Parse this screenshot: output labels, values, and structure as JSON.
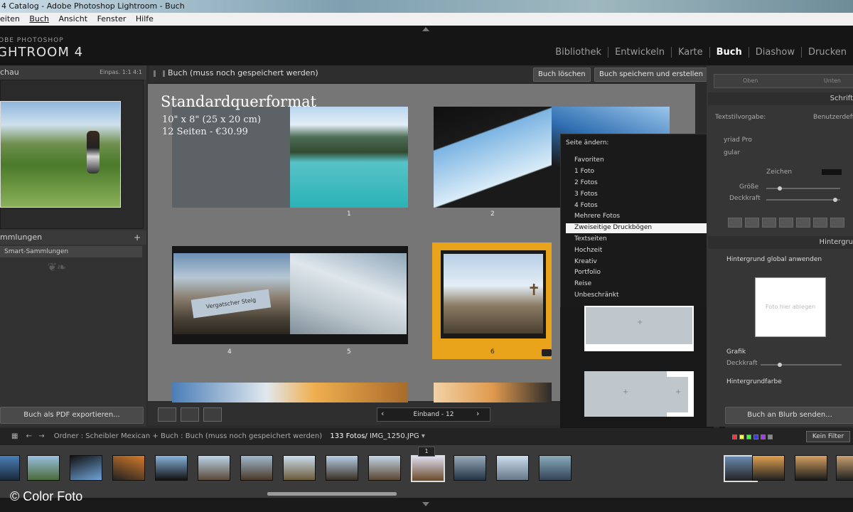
{
  "window": {
    "title": "4 Catalog - Adobe Photoshop Lightroom - Buch"
  },
  "menu": [
    "eiten",
    "Buch",
    "Ansicht",
    "Fenster",
    "Hilfe"
  ],
  "brand": {
    "small": "OBE PHOTOSHOP",
    "big": "GHTROOM 4"
  },
  "modules": [
    "Bibliothek",
    "Entwickeln",
    "Karte",
    "Buch",
    "Diashow",
    "Drucken"
  ],
  "left": {
    "nav_title": "chau",
    "nav_options": "Einpas.  1:1  4:1",
    "collections_title": "mmlungen",
    "smart_collections": "Smart-Sammlungen",
    "pdf_button": "Buch als PDF exportieren..."
  },
  "center": {
    "book_title": "Buch (muss noch gespeichert werden)",
    "delete_button": "Buch löschen",
    "save_button": "Buch speichern und erstellen",
    "format_title": "Standardquerformat",
    "format_size": "10\" x 8\" (25 x 20 cm)",
    "format_pages": "12 Seiten - €30.99",
    "page_numbers": [
      "1",
      "2",
      "4",
      "5",
      "6"
    ],
    "spread_label": "Vergatscher Steig",
    "pager_label": "Einband - 12"
  },
  "popup": {
    "title": "Seite ändern:",
    "items": [
      "Favoriten",
      "1 Foto",
      "2 Fotos",
      "3 Fotos",
      "4 Fotos",
      "Mehrere Fotos",
      "Zweiseitige Druckbögen",
      "Textseiten",
      "Hochzeit",
      "Kreativ",
      "Portfolio",
      "Reise",
      "Unbeschränkt"
    ],
    "selected": "Zweiseitige Druckbögen"
  },
  "right": {
    "top_left": "Oben",
    "top_right": "Unten",
    "text_section": "Schrift",
    "style_label": "Textstilvorgabe:",
    "style_value": "Benutzerdefi",
    "font": "yriad Pro",
    "font_style": "gular",
    "char_label": "Zeichen",
    "size_label": "Größe",
    "opacity_label": "Deckkraft",
    "bg_section": "Hintergru",
    "bg_global": "Hintergrund global anwenden",
    "drop_text": "Foto hier ablegen",
    "graphic_label": "Grafik",
    "bg_opacity": "Deckkraft",
    "bg_color": "Hintergrundfarbe",
    "blurb_button": "Buch an Blurb senden..."
  },
  "filmstrip": {
    "path": "Ordner : Scheibler Mexican  +  Buch : Buch (muss noch gespeichert werden)",
    "count": "133 Fotos/",
    "file": "IMG_1250.JPG",
    "filter": "Kein Filter",
    "page_badge": "1"
  },
  "copyright": "© Color Foto",
  "colors": {
    "accent": "#e8a31a",
    "panel": "#323232",
    "canvas": "#767676"
  }
}
